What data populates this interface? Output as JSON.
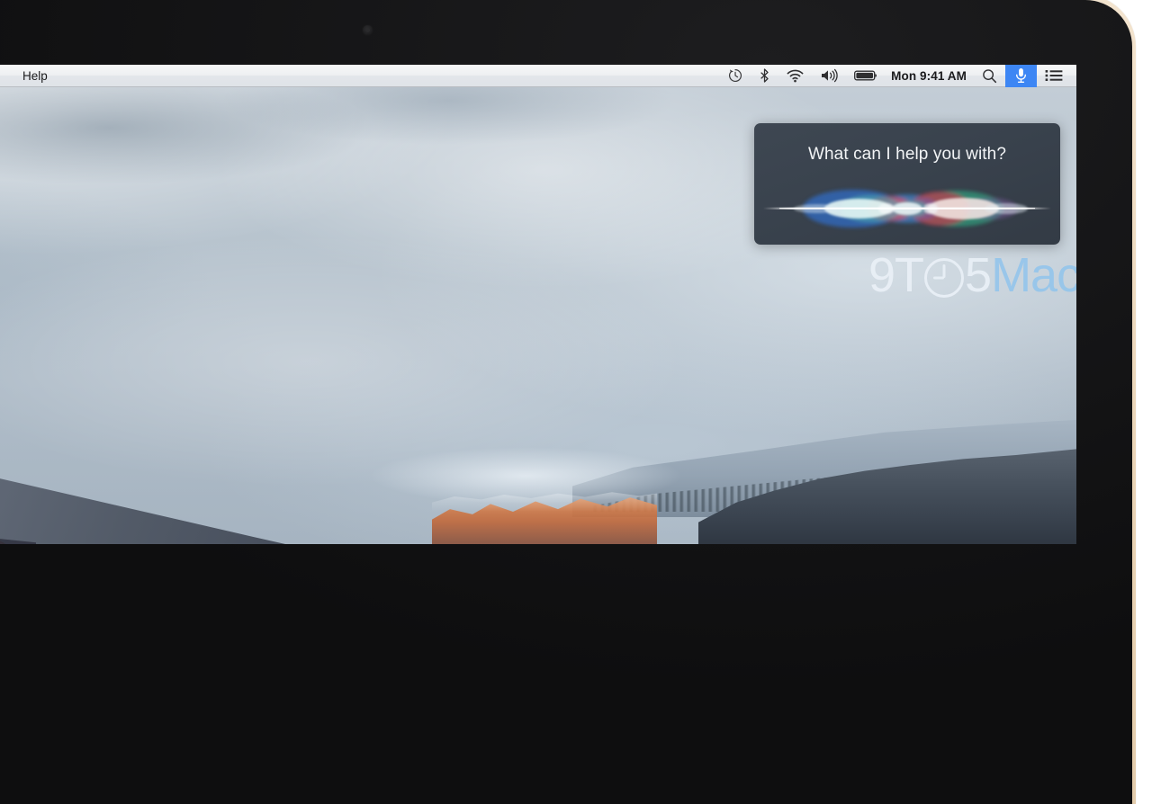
{
  "device": {
    "name": "macbook",
    "camera_label": "facetime-camera",
    "bezel_color": "#111112",
    "lid_edge_color": "#e8d2b4"
  },
  "menubar": {
    "app_menu_items": [
      {
        "label": "Help",
        "name": "menu-help"
      }
    ],
    "status_items": [
      {
        "name": "time-machine-icon",
        "label": "Time Machine"
      },
      {
        "name": "bluetooth-icon",
        "label": "Bluetooth"
      },
      {
        "name": "wifi-icon",
        "label": "Wi-Fi"
      },
      {
        "name": "volume-icon",
        "label": "Volume"
      },
      {
        "name": "battery-icon",
        "label": "Battery"
      }
    ],
    "clock": "Mon 9:41 AM",
    "spotlight_label": "Spotlight Search",
    "siri_label": "Siri",
    "notification_center_label": "Notification Center",
    "siri_highlight_color": "#3d86f4",
    "bar_background": "#eef0f2",
    "text_color": "#1a1a1c"
  },
  "siri_panel": {
    "prompt": "What can I help you with?",
    "background_color": "#39424d",
    "text_color": "#f2f4f6",
    "waveform": {
      "name": "siri-waveform",
      "colors": [
        "#2f6fd0",
        "#3f8ee0",
        "#56c7c4",
        "#d8e9ef",
        "#d93a4e",
        "#e06a9a",
        "#2fa582",
        "#8a5fb0"
      ]
    }
  },
  "wallpaper": {
    "name": "el-capitan-wallpaper",
    "description": "El Capitan granite cliff at sunrise with snowy ridge"
  },
  "watermark": {
    "part_one": "9T",
    "clock_glyph": "O",
    "part_two": "5",
    "part_three": "Mac",
    "light_color": "#e9f0f6",
    "blue_color": "#96c5ea"
  }
}
